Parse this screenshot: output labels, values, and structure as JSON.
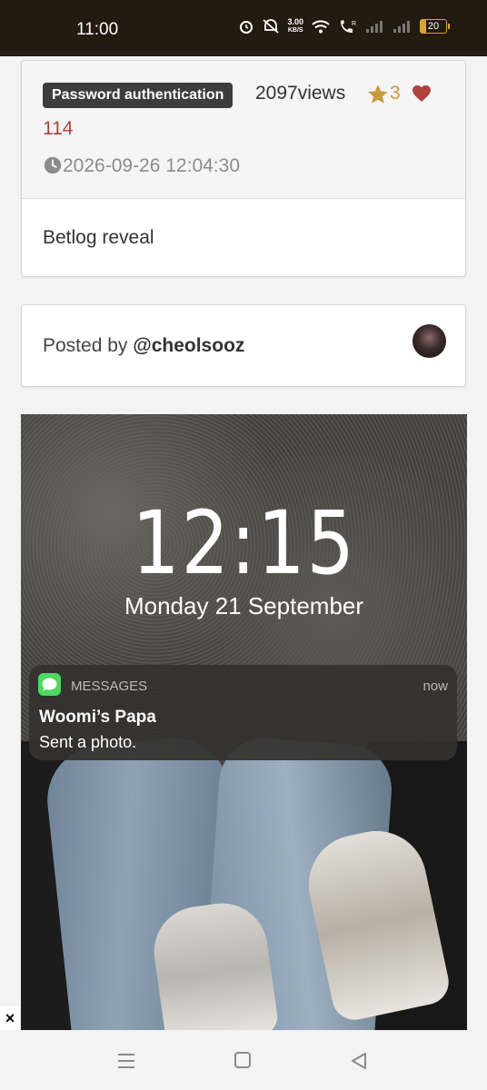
{
  "status_bar": {
    "time": "11:00",
    "net_speed_value": "3.00",
    "net_speed_unit": "KB/S",
    "battery_level": "20",
    "icons": [
      "alarm-icon",
      "mute-icon",
      "wifi-icon",
      "wifi-calling-icon",
      "signal-icon",
      "signal-icon",
      "battery-icon"
    ]
  },
  "post": {
    "tag": "Password authentication",
    "views": "2097views",
    "favorites": "3",
    "likes": "114",
    "date": "2026-09-26 12:04:30",
    "body": "Betlog reveal"
  },
  "author": {
    "prefix": "Posted by ",
    "handle": "@cheolsooz"
  },
  "embedded_screenshot": {
    "lock_time": "12:15",
    "lock_date": "Monday 21 September",
    "notification": {
      "app": "MESSAGES",
      "time": "now",
      "sender": "Woomi’s Papa",
      "message": "Sent a photo."
    }
  },
  "overlay": {
    "close_label": "×"
  },
  "colors": {
    "status_bar_bg": "#231a10",
    "tag_bg": "#3d3d3d",
    "star": "#c89b3c",
    "heart": "#b0413e",
    "battery": "#d8a531",
    "messages_icon": "#4cd964"
  }
}
